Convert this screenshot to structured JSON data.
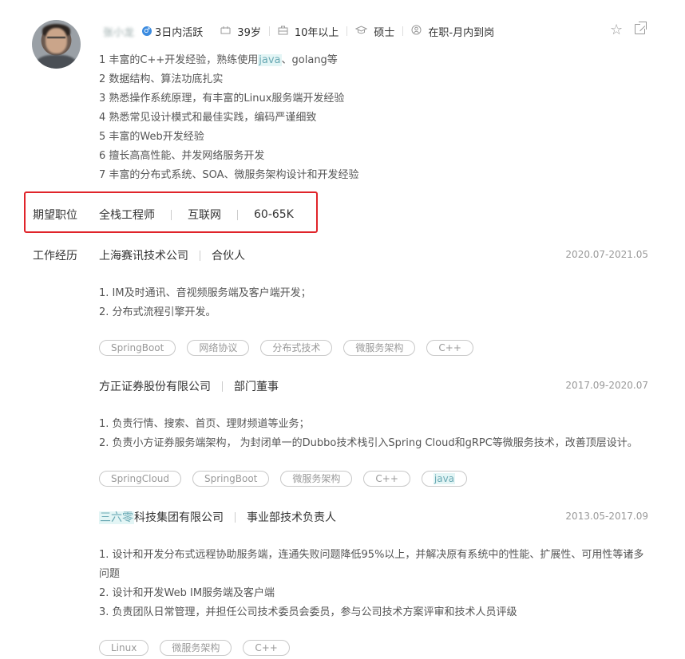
{
  "header": {
    "name": "张小龙",
    "gender_symbol": "♂",
    "active": "3日内活跃",
    "age": "39岁",
    "experience": "10年以上",
    "degree": "硕士",
    "status": "在职-月内到岗",
    "icons": [
      "calendar-icon",
      "briefcase-icon",
      "graduation-cap-icon",
      "status-icon"
    ]
  },
  "actions": {
    "favorite_icon": "star-icon",
    "share_icon": "external-link-icon"
  },
  "summary": [
    {
      "pre": "1 丰富的C++开发经验，熟练使用",
      "hl": "java",
      "post": "、golang等"
    },
    {
      "pre": "2 数据结构、算法功底扎实"
    },
    {
      "pre": "3 熟悉操作系统原理，有丰富的Linux服务端开发经验"
    },
    {
      "pre": "4 熟悉常见设计模式和最佳实践，编码严谨细致"
    },
    {
      "pre": "5 丰富的Web开发经验"
    },
    {
      "pre": "6 擅长高高性能、并发网络服务开发"
    },
    {
      "pre": "7 丰富的分布式系统、SOA、微服务架构设计和开发经验"
    }
  ],
  "expectation": {
    "label": "期望职位",
    "position": "全栈工程师",
    "industry": "互联网",
    "salary": "60-65K",
    "highlight_color": "#e0242a"
  },
  "work": {
    "label": "工作经历",
    "jobs": [
      {
        "company": "上海赛讯技术公司",
        "title": "合伙人",
        "date": "2020.07-2021.05",
        "desc": [
          "1. IM及时通讯、音视频服务端及客户端开发；",
          "2. 分布式流程引擎开发。"
        ],
        "tags": [
          "SpringBoot",
          "网络协议",
          "分布式技术",
          "微服务架构",
          "C++"
        ]
      },
      {
        "company": "方正证券股份有限公司",
        "title": "部门董事",
        "date": "2017.09-2020.07",
        "desc": [
          "1. 负责行情、搜索、首页、理财频道等业务；",
          "2. 负责小方证券服务端架构， 为封闭单一的Dubbo技术栈引入Spring Cloud和gRPC等微服务技术，改善顶层设计。"
        ],
        "tags": [
          "SpringCloud",
          "SpringBoot",
          "微服务架构",
          "C++",
          "java"
        ]
      },
      {
        "company_hl": "三六零",
        "company": "科技集团有限公司",
        "title": "事业部技术负责人",
        "date": "2013.05-2017.09",
        "desc": [
          "1. 设计和开发分布式远程协助服务端，连通失败问题降低95%以上，并解决原有系统中的性能、扩展性、可用性等诸多",
          "问题",
          "2. 设计和开发Web IM服务端及客户端",
          "3. 负责团队日常管理，并担任公司技术委员会委员，参与公司技术方案评审和技术人员评级"
        ],
        "tags": [
          "Linux",
          "微服务架构",
          "C++"
        ]
      }
    ]
  }
}
